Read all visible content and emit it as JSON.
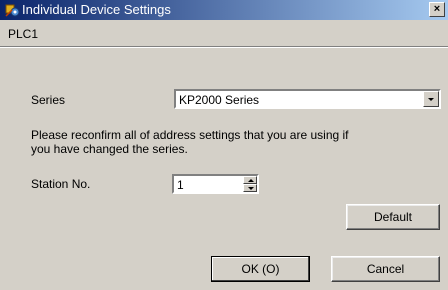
{
  "window": {
    "title": "Individual Device Settings",
    "close_glyph": "×"
  },
  "header": {
    "device": "PLC1"
  },
  "series": {
    "label": "Series",
    "value": "KP2000 Series"
  },
  "note": {
    "line1": "Please reconfirm all of address settings that you are using if",
    "line2": "you have changed the series."
  },
  "station": {
    "label": "Station No.",
    "value": "1"
  },
  "buttons": {
    "default": "Default",
    "ok": "OK (O)",
    "cancel": "Cancel"
  },
  "colors": {
    "titlebar_start": "#0a246a",
    "titlebar_end": "#a6caf0",
    "dialog_bg": "#d4d0c8"
  }
}
